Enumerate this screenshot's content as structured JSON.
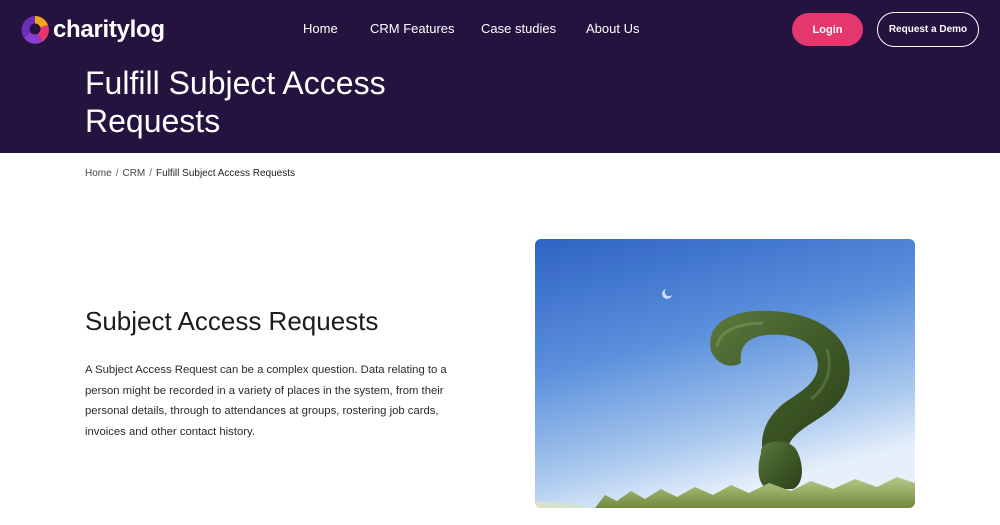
{
  "brand": {
    "name": "charitylog"
  },
  "nav": {
    "items": [
      {
        "label": "Home"
      },
      {
        "label": "CRM Features"
      },
      {
        "label": "Case studies"
      },
      {
        "label": "About Us"
      }
    ]
  },
  "actions": {
    "login_label": "Login",
    "demo_label": "Request a Demo"
  },
  "hero": {
    "title": "Fulfill Subject Access Requests"
  },
  "breadcrumb": {
    "items": [
      {
        "label": "Home"
      },
      {
        "label": "CRM"
      }
    ],
    "current": "Fulfill Subject Access Requests",
    "separator": "/"
  },
  "content": {
    "heading": "Subject Access Requests",
    "paragraph": "A Subject Access Request can be a complex question. Data relating to a person might be recorded in a variety of places in the system, from their personal details, through to attendances at groups, rostering job cards, invoices and other contact history."
  },
  "image": {
    "icon": "question-mark-hedge-image"
  },
  "colors": {
    "header_bg": "#24123f",
    "login_bg": "#e4376e"
  }
}
